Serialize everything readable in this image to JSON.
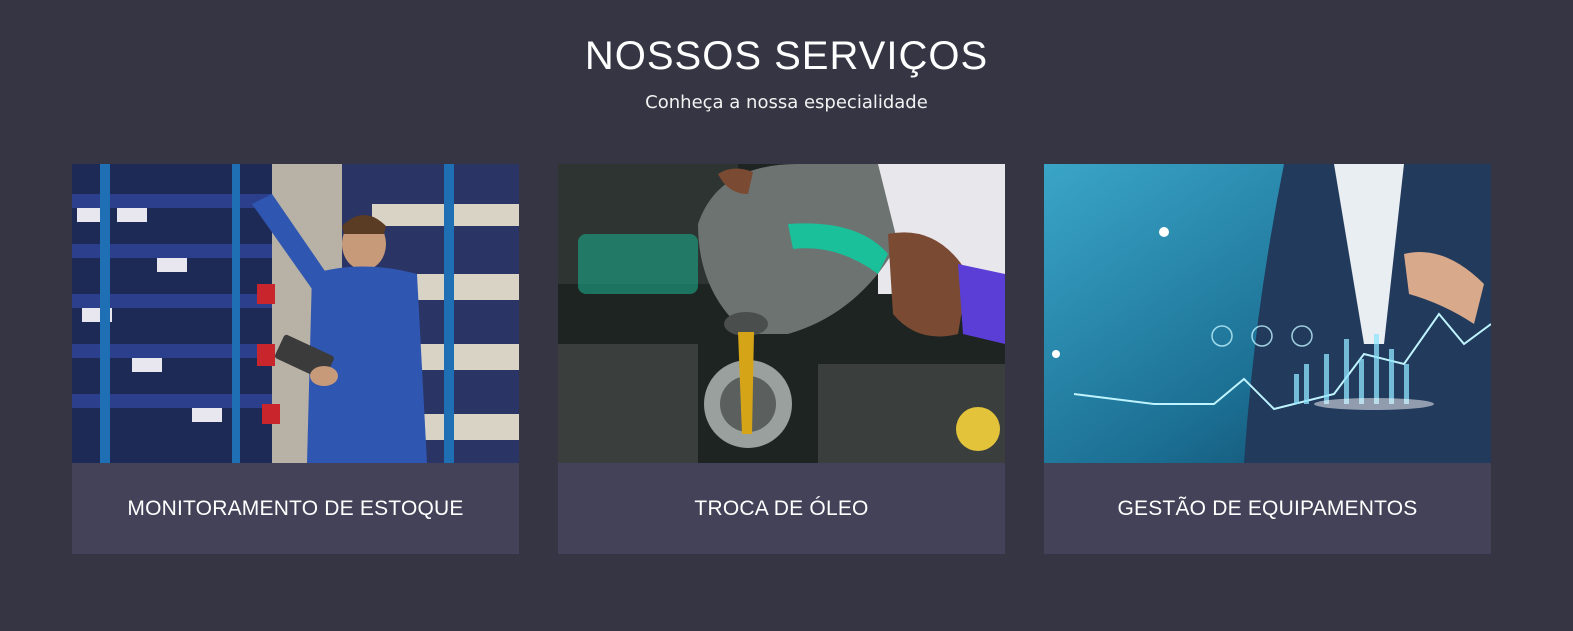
{
  "section": {
    "title": "NOSSOS SERVIÇOS",
    "subtitle": "Conheça a nossa especialidade"
  },
  "services": [
    {
      "label": "MONITORAMENTO DE ESTOQUE",
      "image": "warehouse-inventory-photo"
    },
    {
      "label": "TROCA DE ÓLEO",
      "image": "oil-change-photo"
    },
    {
      "label": "GESTÃO DE EQUIPAMENTOS",
      "image": "equipment-analytics-photo"
    }
  ],
  "colors": {
    "background": "#363543",
    "card": "#434258",
    "text": "#ffffff"
  }
}
